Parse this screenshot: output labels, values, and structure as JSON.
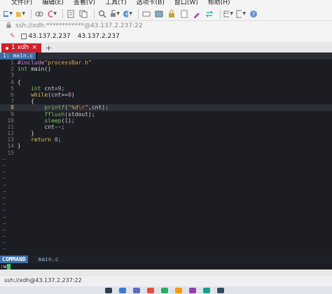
{
  "menu": [
    "文件(F)",
    "编辑(E)",
    "查看(V)",
    "工具(T)",
    "选项卡(B)",
    "窗口(W)",
    "帮助(H)"
  ],
  "address": {
    "text": "ssh://xdh:************@43.137.2.237:22",
    "icon": "lock-icon"
  },
  "session": {
    "label": "43.137.2.237",
    "label2": "43.137.2.237"
  },
  "tab": {
    "label": "1 xdh",
    "add": "+"
  },
  "vim": {
    "tab_label": "1: main.c",
    "lines": [
      {
        "n": "1"
      },
      {
        "n": "2"
      },
      {
        "n": "3"
      },
      {
        "n": "4"
      },
      {
        "n": "5"
      },
      {
        "n": "6"
      },
      {
        "n": "7"
      },
      {
        "n": "8"
      },
      {
        "n": "9"
      },
      {
        "n": "10"
      },
      {
        "n": "11"
      },
      {
        "n": "12"
      },
      {
        "n": "13"
      },
      {
        "n": "14"
      },
      {
        "n": "15"
      }
    ],
    "code": {
      "l1_dir": "#include",
      "l1_str": "\"processBar.h\"",
      "l2_type": "int",
      "l2_fn": " main()",
      "l4": "{",
      "l5_type": "int",
      "l5_rest": " cnt=",
      "l5_num": "9",
      "l5_end": ";",
      "l6_kw": "while",
      "l6_rest": "(cnt>=",
      "l6_num": "0",
      "l6_end": ")",
      "l7": "{",
      "l8_fn": "printf",
      "l8_open": "(",
      "l8_str1": "\"%d",
      "l8_esc": "\\r",
      "l8_str2": "\"",
      "l8_rest": ",cnt);",
      "l9_fn": "fflush",
      "l9_rest": "(stdout);",
      "l10_fn": "sleep",
      "l10_open": "(",
      "l10_num": "1",
      "l10_rest": ");",
      "l11": "cnt--;",
      "l12": "}",
      "l13_kw": "return",
      "l13_num": "0",
      "l13_end": ";",
      "l14": "}"
    },
    "tilde": "~",
    "mode": "COMMAND",
    "filename": "main.c",
    "cmd": ":w"
  },
  "statusbar": {
    "text": "ssh://xdh@43.137.2.237:22"
  },
  "colors": {
    "tab_active": "#d11f2a",
    "terminal_bg": "#1b1d22",
    "vim_tab": "#3b6ea5"
  }
}
